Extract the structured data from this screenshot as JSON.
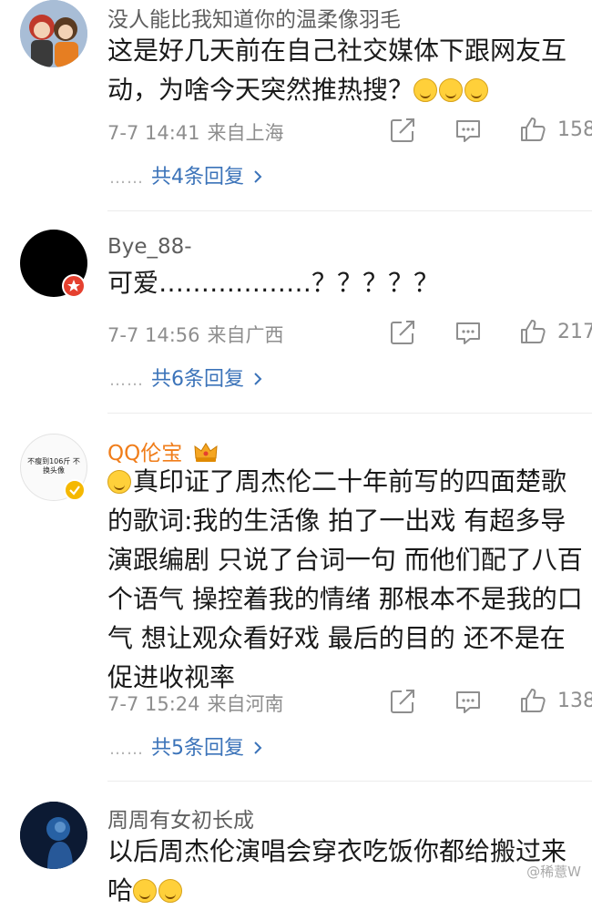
{
  "comments": [
    {
      "username": "没人能比我知道你的温柔像羽毛",
      "text": "这是好几天前在自己社交媒体下跟网友互动，为啥今天突然推热搜？",
      "time": "7-7 14:41",
      "location": "来自上海",
      "likes": "158",
      "replies": "共4条回复",
      "avatar": "cartoon-couple-avatar"
    },
    {
      "username": "Bye_88-",
      "text": "可爱………………？？？？？",
      "time": "7-7 14:56",
      "location": "来自广西",
      "likes": "217",
      "replies": "共6条回复",
      "avatar": "black-avatar"
    },
    {
      "username": "QQ伦宝",
      "text": "真印证了周杰伦二十年前写的四面楚歌的歌词:我的生活像 拍了一出戏 有超多导演跟编剧 只说了台词一句 而他们配了八百个语气 操控着我的情绪 那根本不是我的口气 想让观众看好戏 最后的目的 还不是在促进收视率",
      "time": "7-7 15:24",
      "location": "来自河南",
      "likes": "138",
      "replies": "共5条回复",
      "avatar_text": "不瘦到106斤 不换头像"
    },
    {
      "username": "周周有女初长成",
      "text": "以后周杰伦演唱会穿衣吃饭你都给搬过来哈",
      "avatar": "blue-figure-avatar"
    }
  ],
  "reply_dots": "……",
  "watermark": "@稀薏W",
  "colors": {
    "username": "#5f5f5f",
    "vip_username": "#f07d1a",
    "reply_link": "#3b73b9",
    "meta": "#8e8e8e",
    "verified_badge": "#f5b800",
    "red_badge": "#e5402f"
  }
}
